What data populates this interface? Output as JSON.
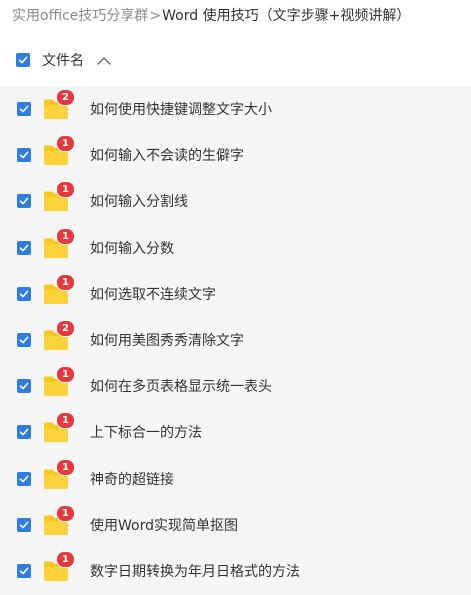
{
  "breadcrumb": {
    "parent": "实用office技巧分享群",
    "separator": ">",
    "current": "Word 使用技巧（文字步骤+视频讲解）"
  },
  "list_header": {
    "column_label": "文件名",
    "select_all_checked": true,
    "sort_icon": "chevron-up-icon"
  },
  "icons": {
    "checkbox": "checkbox-checked-icon",
    "folder": "folder-icon"
  },
  "colors": {
    "checkbox": "#2f7de1",
    "folder": "#f8c91c",
    "badge": "#e8383d",
    "list_background": "#f5f5f5"
  },
  "files": [
    {
      "name": "如何使用快捷键调整文字大小",
      "badge": "2",
      "checked": true
    },
    {
      "name": "如何输入不会读的生僻字",
      "badge": "1",
      "checked": true
    },
    {
      "name": "如何输入分割线",
      "badge": "1",
      "checked": true
    },
    {
      "name": "如何输入分数",
      "badge": "1",
      "checked": true
    },
    {
      "name": "如何选取不连续文字",
      "badge": "1",
      "checked": true
    },
    {
      "name": "如何用美图秀秀清除文字",
      "badge": "2",
      "checked": true
    },
    {
      "name": "如何在多页表格显示统一表头",
      "badge": "1",
      "checked": true
    },
    {
      "name": "上下标合一的方法",
      "badge": "1",
      "checked": true
    },
    {
      "name": "神奇的超链接",
      "badge": "1",
      "checked": true
    },
    {
      "name": "使用Word实现简单抠图",
      "badge": "1",
      "checked": true
    },
    {
      "name": "数字日期转换为年月日格式的方法",
      "badge": "1",
      "checked": true
    }
  ]
}
